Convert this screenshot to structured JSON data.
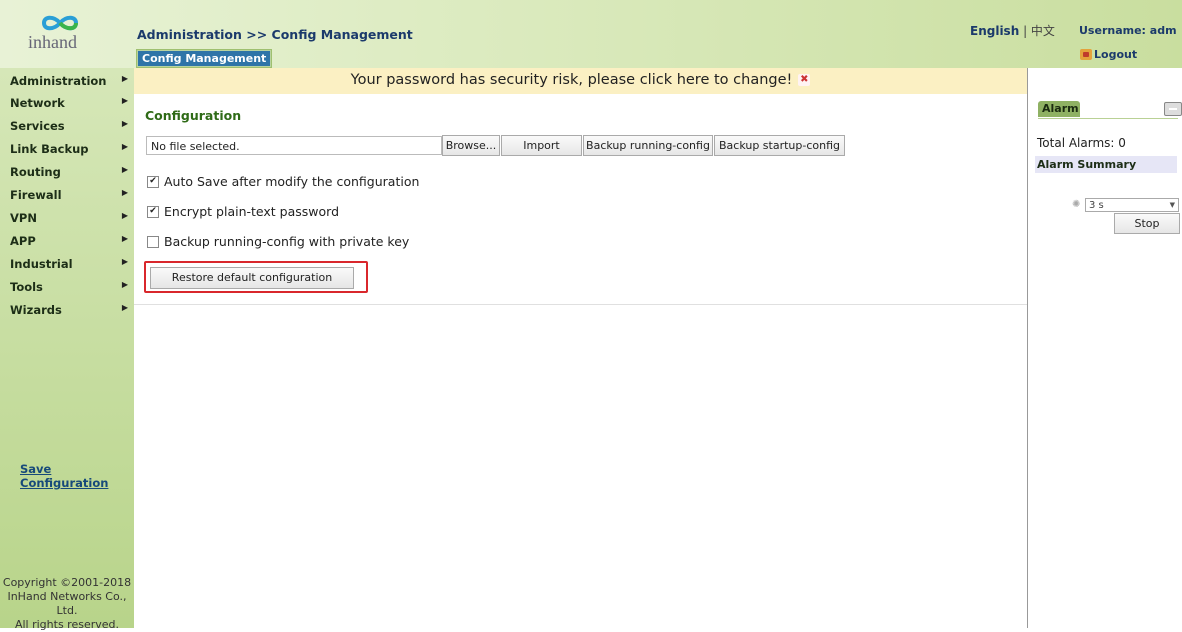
{
  "header": {
    "logo_text": "inhand",
    "breadcrumb": "Administration >> Config Management",
    "tab_label": "Config Management",
    "lang_english": "English",
    "lang_separator": " | ",
    "lang_chinese": "中文",
    "username_text": "Username: adm",
    "logout_label": "Logout"
  },
  "sidebar": {
    "items": [
      {
        "label": "Administration"
      },
      {
        "label": "Network"
      },
      {
        "label": "Services"
      },
      {
        "label": "Link Backup"
      },
      {
        "label": "Routing"
      },
      {
        "label": "Firewall"
      },
      {
        "label": "VPN"
      },
      {
        "label": "APP"
      },
      {
        "label": "Industrial"
      },
      {
        "label": "Tools"
      },
      {
        "label": "Wizards"
      }
    ],
    "save_label": "Save Configuration",
    "copyright": [
      "Copyright ©2001-2018",
      "InHand Networks Co., Ltd.",
      "All rights reserved."
    ]
  },
  "main": {
    "alert_text": "Your password has security risk, please click here to change!",
    "section_title": "Configuration",
    "file_input_value": "No file selected.",
    "browse_label": "Browse...",
    "import_label": "Import",
    "backup_running_label": "Backup running-config",
    "backup_startup_label": "Backup startup-config",
    "auto_save_label": "Auto Save after modify the configuration",
    "auto_save_checked": true,
    "encrypt_label": "Encrypt plain-text password",
    "encrypt_checked": true,
    "private_key_label": "Backup running-config with private key",
    "private_key_checked": false,
    "restore_label": "Restore default configuration"
  },
  "alarm": {
    "tab_label": "Alarm",
    "total_label": "Total Alarms: 0",
    "summary_label": "Alarm Summary",
    "interval_value": "3 s",
    "stop_label": "Stop"
  },
  "colors": {
    "highlight_border": "#d9272c",
    "accent_green": "#2f6b17",
    "tab_blue": "#2e74a8"
  }
}
